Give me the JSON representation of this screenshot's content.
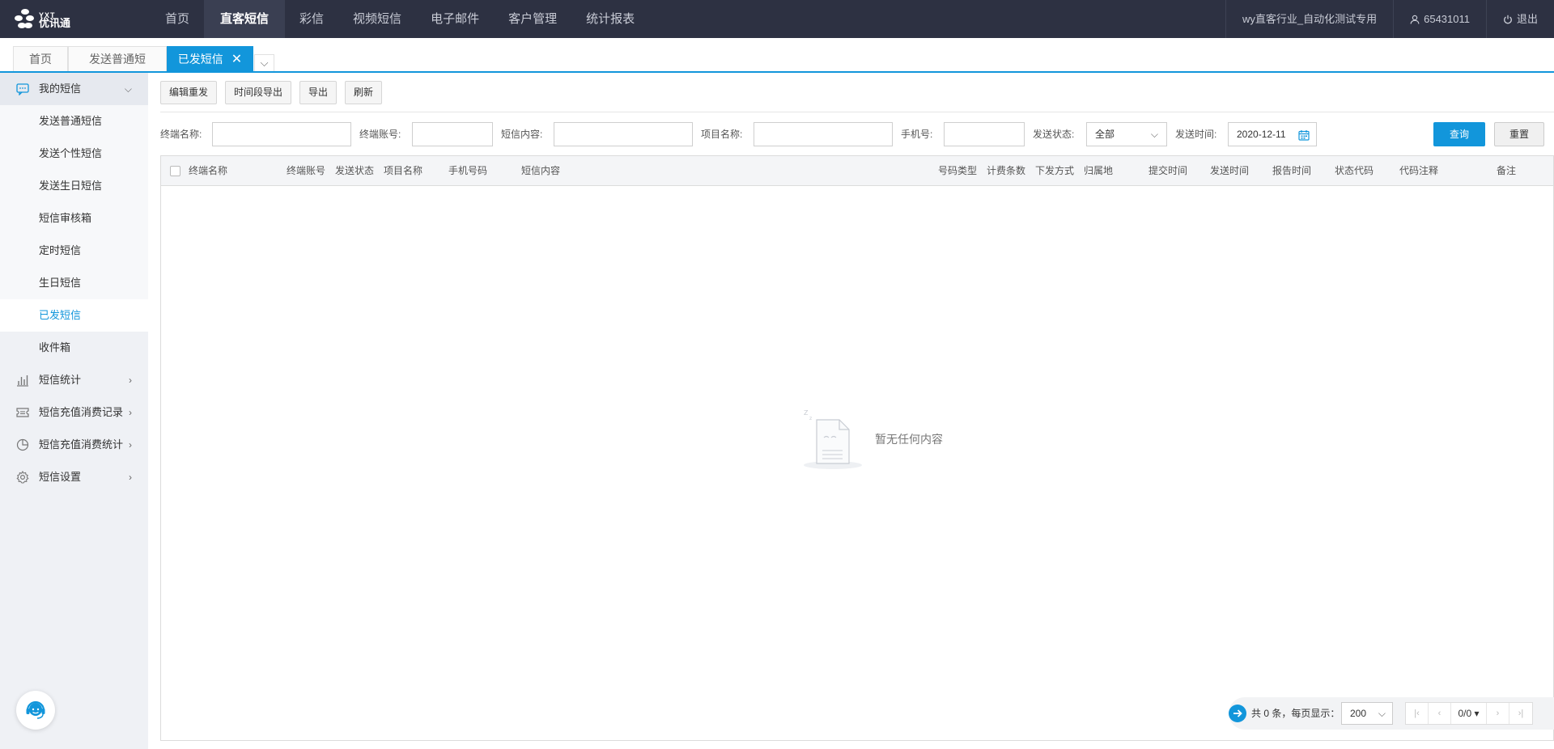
{
  "logo": {
    "en": "YXT",
    "cn": "优讯通"
  },
  "topnav": {
    "items": [
      "首页",
      "直客短信",
      "彩信",
      "视频短信",
      "电子邮件",
      "客户管理",
      "统计报表"
    ],
    "active_index": 1
  },
  "topright": {
    "company": "wy直客行业_自动化测试专用",
    "user": "65431011",
    "logout": "退出"
  },
  "tabs": {
    "items": [
      "首页",
      "发送普通短",
      "已发短信"
    ],
    "close": "✕",
    "more": "⌵"
  },
  "sidebar": {
    "my_sms": "我的短信",
    "sub_items": [
      "发送普通短信",
      "发送个性短信",
      "发送生日短信",
      "短信审核箱",
      "定时短信",
      "生日短信",
      "已发短信",
      "收件箱"
    ],
    "other_items": [
      "短信统计",
      "短信充值消费记录",
      "短信充值消费统计",
      "短信设置"
    ]
  },
  "toolbar": {
    "edit_resend": "编辑重发",
    "export_range": "时间段导出",
    "export": "导出",
    "refresh": "刷新"
  },
  "filters": {
    "terminal_name_label": "终端名称:",
    "terminal_account_label": "终端账号:",
    "content_label": "短信内容:",
    "project_label": "项目名称:",
    "phone_label": "手机号:",
    "status_label": "发送状态:",
    "status_value": "全部",
    "time_label": "发送时间:",
    "time_value": "2020-12-11",
    "query": "查询",
    "reset": "重置"
  },
  "table": {
    "columns": [
      "终端名称",
      "终端账号",
      "发送状态",
      "项目名称",
      "手机号码",
      "短信内容",
      "号码类型",
      "计费条数",
      "下发方式",
      "归属地",
      "提交时间",
      "发送时间",
      "报告时间",
      "状态代码",
      "代码注释",
      "备注"
    ],
    "empty_text": "暂无任何内容"
  },
  "pager": {
    "summary": "共 0 条，每页显示：",
    "page_size": "200",
    "page": "0/0",
    "first": "|‹",
    "prev": "‹",
    "next": "›",
    "last": "›|"
  },
  "colors": {
    "accent": "#1296db",
    "navbar": "#2d3142",
    "sidebar": "#eff1f5"
  }
}
